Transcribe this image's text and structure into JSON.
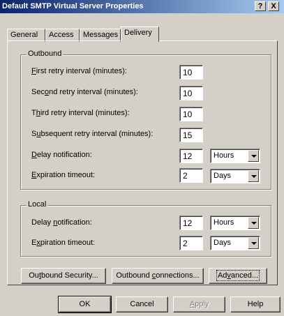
{
  "window": {
    "title": "Default SMTP Virtual Server Properties",
    "help_glyph": "?",
    "close_glyph": "X"
  },
  "tabs": [
    {
      "label": "General"
    },
    {
      "label": "Access"
    },
    {
      "label": "Messages"
    },
    {
      "label": "Delivery"
    }
  ],
  "outbound": {
    "title": "Outbound",
    "first_retry": {
      "label_pre": "",
      "label_key": "F",
      "label_post": "irst retry interval (minutes):",
      "value": "10"
    },
    "second_retry": {
      "label_pre": "Sec",
      "label_key": "o",
      "label_post": "nd retry interval (minutes):",
      "value": "10"
    },
    "third_retry": {
      "label_pre": "T",
      "label_key": "h",
      "label_post": "ird retry interval (minutes):",
      "value": "10"
    },
    "subsequent_retry": {
      "label_pre": "S",
      "label_key": "u",
      "label_post": "bsequent retry interval (minutes):",
      "value": "15"
    },
    "delay_notification": {
      "label_pre": "",
      "label_key": "D",
      "label_post": "elay notification:",
      "value": "12",
      "unit": "Hours"
    },
    "expiration_timeout": {
      "label_pre": "",
      "label_key": "E",
      "label_post": "xpiration timeout:",
      "value": "2",
      "unit": "Days"
    }
  },
  "local": {
    "title": "Local",
    "delay_notification": {
      "label_pre": "Delay ",
      "label_key": "n",
      "label_post": "otification:",
      "value": "12",
      "unit": "Hours"
    },
    "expiration_timeout": {
      "label_pre": "E",
      "label_key": "x",
      "label_post": "piration timeout:",
      "value": "2",
      "unit": "Days"
    }
  },
  "buttons": {
    "outbound_security": {
      "pre": "Ou",
      "key": "t",
      "post": "bound Security..."
    },
    "outbound_connections": {
      "pre": "Outbound ",
      "key": "c",
      "post": "onnections..."
    },
    "advanced": {
      "pre": "Ad",
      "key": "v",
      "post": "anced..."
    },
    "ok": "OK",
    "cancel": "Cancel",
    "apply": {
      "pre": "",
      "key": "A",
      "post": "pply"
    },
    "help": "Help"
  }
}
